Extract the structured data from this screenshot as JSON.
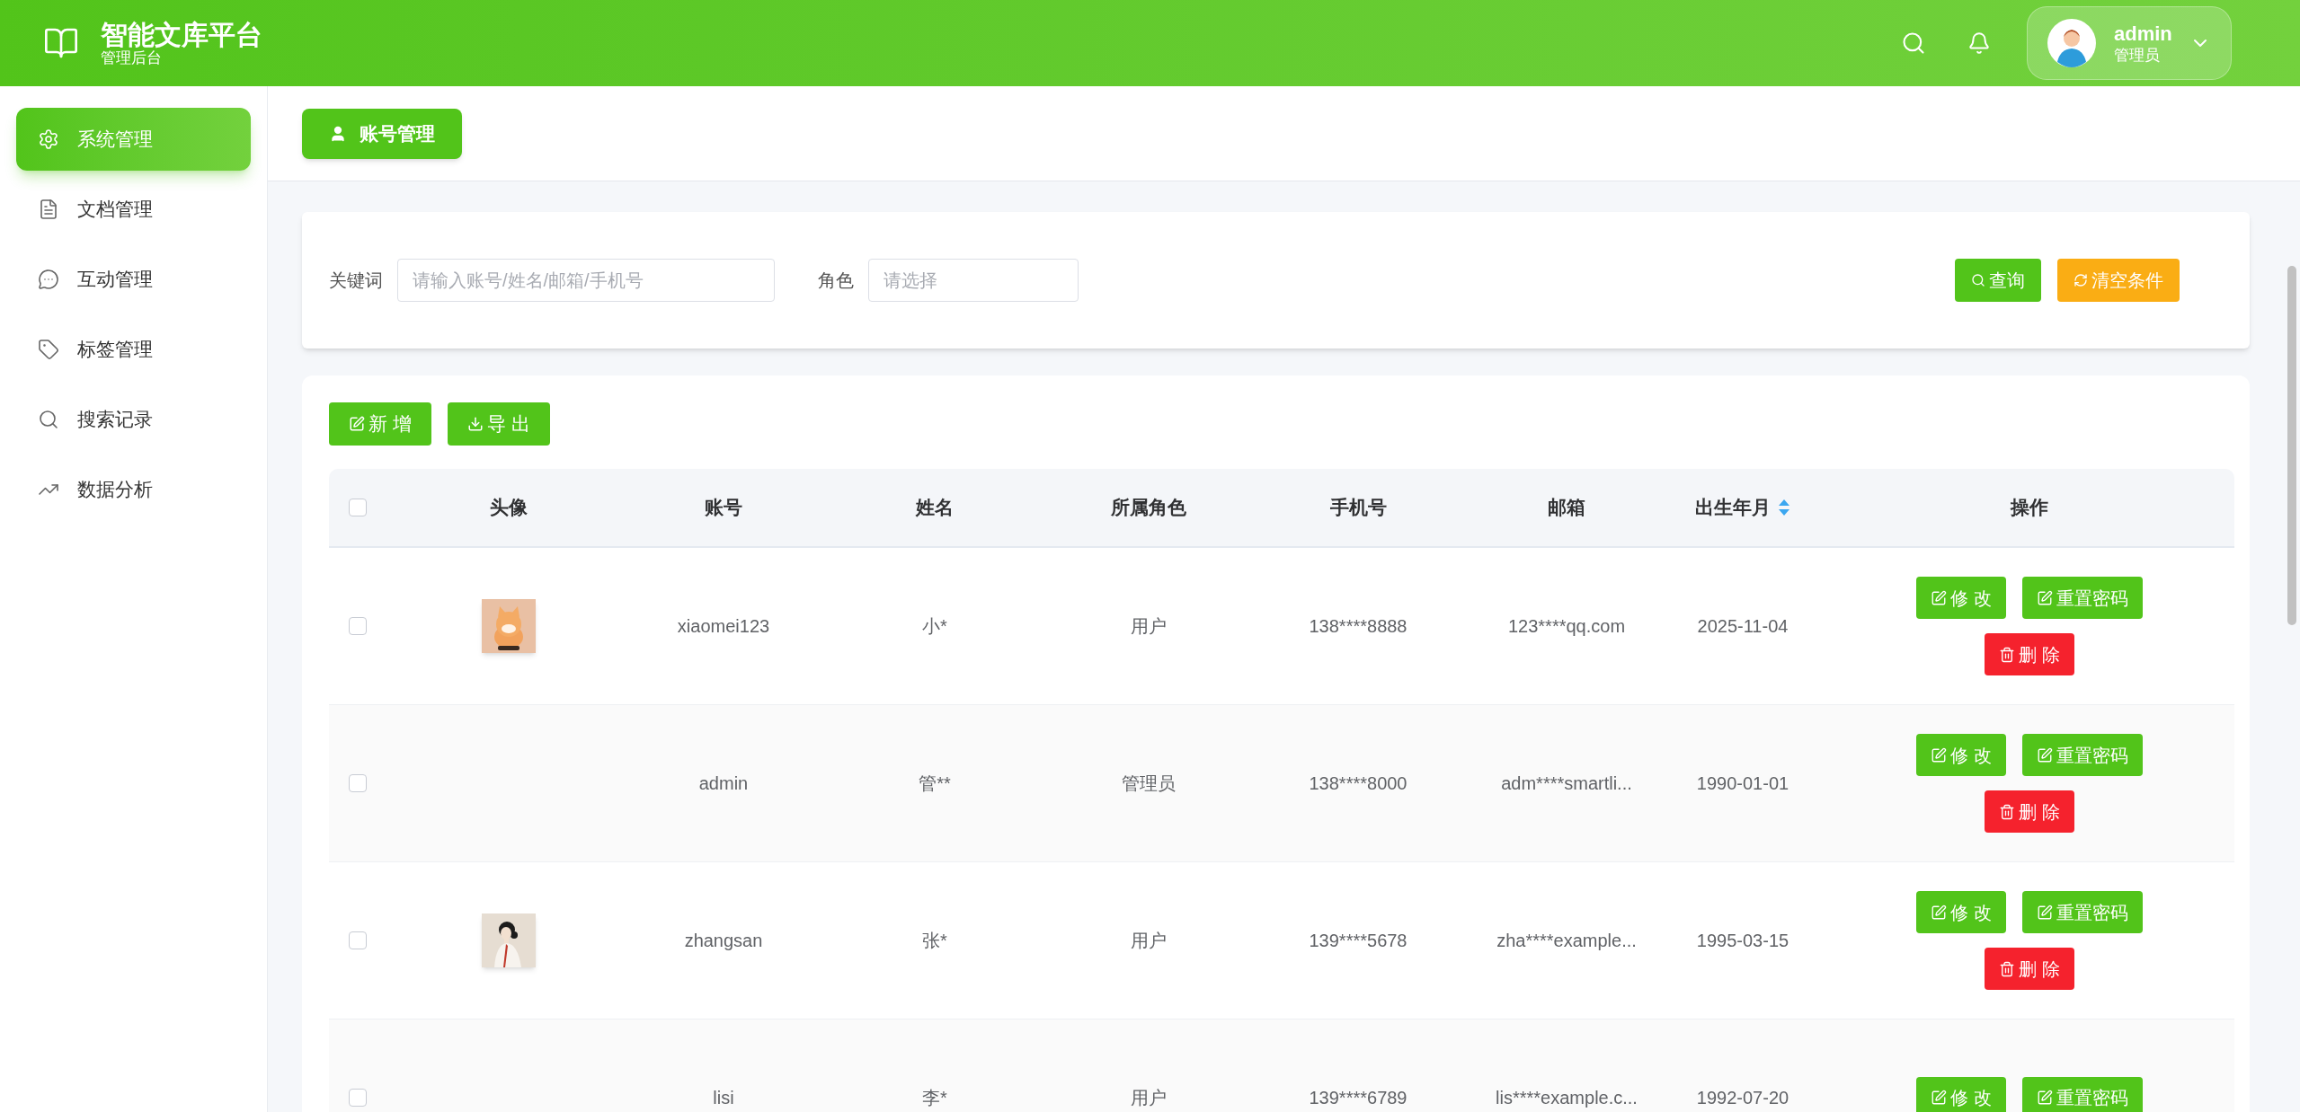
{
  "header": {
    "title": "智能文库平台",
    "subtitle": "管理后台",
    "user": {
      "name": "admin",
      "role": "管理员"
    }
  },
  "sidebar": {
    "items": [
      {
        "label": "系统管理",
        "selected": true
      },
      {
        "label": "文档管理",
        "selected": false
      },
      {
        "label": "互动管理",
        "selected": false
      },
      {
        "label": "标签管理",
        "selected": false
      },
      {
        "label": "搜索记录",
        "selected": false
      },
      {
        "label": "数据分析",
        "selected": false
      }
    ]
  },
  "tabs": [
    {
      "label": "账号管理",
      "selected": true
    }
  ],
  "filters": {
    "keyword": {
      "label": "关键词",
      "placeholder": "请输入账号/姓名/邮箱/手机号"
    },
    "role": {
      "label": "角色",
      "placeholder": "请选择"
    },
    "buttons": [
      {
        "label": "查询",
        "kind": "search"
      },
      {
        "label": "清空条件",
        "kind": "reset"
      }
    ]
  },
  "toolbar": [
    {
      "label": "新 增",
      "kind": "add"
    },
    {
      "label": "导 出",
      "kind": "export"
    }
  ],
  "table": {
    "select_all": {
      "checked": false
    },
    "columns": [
      {
        "label": "头像",
        "sortable": false
      },
      {
        "label": "账号",
        "sortable": false
      },
      {
        "label": "姓名",
        "sortable": false
      },
      {
        "label": "所属角色",
        "sortable": false
      },
      {
        "label": "手机号",
        "sortable": false
      },
      {
        "label": "邮箱",
        "sortable": false
      },
      {
        "label": "出生年月",
        "sortable": true
      },
      {
        "label": "操作",
        "sortable": false
      }
    ],
    "rows": [
      {
        "checked": false,
        "avatar": {
          "kind": "picture"
        },
        "account": "xiaomei123",
        "name": "小*",
        "role": "用户",
        "phone": "138****8888",
        "email": "123****qq.com",
        "birth": "2025-11-04",
        "actions": [
          {
            "label": "修 改",
            "kind": "edit"
          },
          {
            "label": "重置密码",
            "kind": "edit"
          },
          {
            "label": "删 除",
            "kind": "delete"
          }
        ]
      },
      {
        "checked": false,
        "account": "admin",
        "name": "管**",
        "role": "管理员",
        "phone": "138****8000",
        "email": "adm****smartli...",
        "birth": "1990-01-01",
        "actions": [
          {
            "label": "修 改",
            "kind": "edit"
          },
          {
            "label": "重置密码",
            "kind": "edit"
          },
          {
            "label": "删 除",
            "kind": "delete"
          }
        ]
      },
      {
        "checked": false,
        "avatar": {
          "kind": "picture"
        },
        "account": "zhangsan",
        "name": "张*",
        "role": "用户",
        "phone": "139****5678",
        "email": "zha****example...",
        "birth": "1995-03-15",
        "actions": [
          {
            "label": "修 改",
            "kind": "edit"
          },
          {
            "label": "重置密码",
            "kind": "edit"
          },
          {
            "label": "删 除",
            "kind": "delete"
          }
        ]
      },
      {
        "checked": false,
        "account": "lisi",
        "name": "李*",
        "role": "用户",
        "phone": "139****6789",
        "email": "lis****example.c...",
        "birth": "1992-07-20",
        "actions": [
          {
            "label": "修 改",
            "kind": "edit"
          },
          {
            "label": "重置密码",
            "kind": "edit"
          }
        ]
      }
    ]
  }
}
